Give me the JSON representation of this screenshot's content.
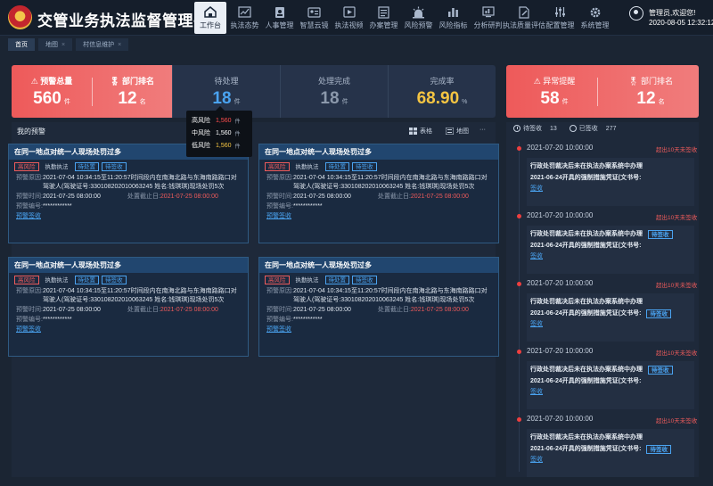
{
  "app": {
    "title": "交管业务执法监督管理平台"
  },
  "nav": [
    {
      "label": "工作台",
      "icon": "home-icon"
    },
    {
      "label": "执法态势",
      "icon": "trend-chart-icon"
    },
    {
      "label": "人事管理",
      "icon": "id-badge-icon"
    },
    {
      "label": "智慧云镜",
      "icon": "id-card-icon"
    },
    {
      "label": "执法视频",
      "icon": "video-play-icon"
    },
    {
      "label": "办案管理",
      "icon": "case-list-icon"
    },
    {
      "label": "风险预警",
      "icon": "alarm-light-icon"
    },
    {
      "label": "风险指标",
      "icon": "bar-chart-icon"
    },
    {
      "label": "分析研判",
      "icon": "analysis-screen-icon"
    },
    {
      "label": "执法质量评估",
      "icon": "document-edit-icon"
    },
    {
      "label": "配置管理",
      "icon": "sliders-icon"
    },
    {
      "label": "系统管理",
      "icon": "gear-icon"
    }
  ],
  "user": {
    "greeting": "管理员,欢迎您!",
    "datetime": "2020-08-05 12:32:12"
  },
  "tabs": [
    {
      "label": "首页"
    },
    {
      "label": "地图"
    },
    {
      "label": "村信息维护"
    }
  ],
  "stats": {
    "total": {
      "label": "预警总量",
      "value": "560",
      "unit": "件"
    },
    "rank": {
      "label": "部门排名",
      "value": "12",
      "unit": "名"
    },
    "pending": {
      "label": "待处理",
      "value": "18",
      "unit": "件"
    },
    "done": {
      "label": "处理完成",
      "value": "18",
      "unit": "件"
    },
    "rate": {
      "label": "完成率",
      "value": "68.90",
      "unit": "%"
    }
  },
  "tooltip": [
    {
      "label": "高风险",
      "value": "1,560",
      "unit": "件",
      "color": "#ff4d4d"
    },
    {
      "label": "中风险",
      "value": "1,560",
      "unit": "件",
      "color": "#ffffff"
    },
    {
      "label": "低风险",
      "value": "1,560",
      "unit": "件",
      "color": "#f5c542"
    }
  ],
  "main": {
    "title": "我的预警",
    "view_table": "表格",
    "view_map": "地图",
    "more": "···"
  },
  "card": {
    "title": "在同一地点对统一人现场处罚过多",
    "tag_risk": "高风险",
    "tag_type": "执勤执法",
    "tag_pending": "待处置",
    "tag_sign": "待签收",
    "reason_label": "预警原因:",
    "reason_text": "2021-07-04 10:34:15至11:20:57时间段内在南海北路与东海南路路口对驾驶人(驾驶证号:330108202010063245 姓名:钱琪琪)现场处罚5次",
    "time_label": "预警时间:",
    "time_value": "2021-07-25 08:00:00",
    "deadline_label": "处置截止日:",
    "deadline_value": "2021-07-25 08:00:00",
    "code_label": "预警编号:",
    "code_value": "************",
    "action": "预警签收"
  },
  "right": {
    "abnormal": {
      "label": "异常提醒",
      "value": "58",
      "unit": "件"
    },
    "rank": {
      "label": "部门排名",
      "value": "12",
      "unit": "名"
    },
    "pending_label": "待签收",
    "pending_count": "13",
    "signed_label": "已签收",
    "signed_count": "277",
    "item": {
      "date": "2021-07-20 10:00:00",
      "overdue": "超出10天未签收",
      "line1": "行政处罚裁决后未在执法办案系统中办理",
      "line2": "2021-06-24开具的强制措施凭证(文书号:",
      "tag": "待签收",
      "action": "签收"
    }
  }
}
